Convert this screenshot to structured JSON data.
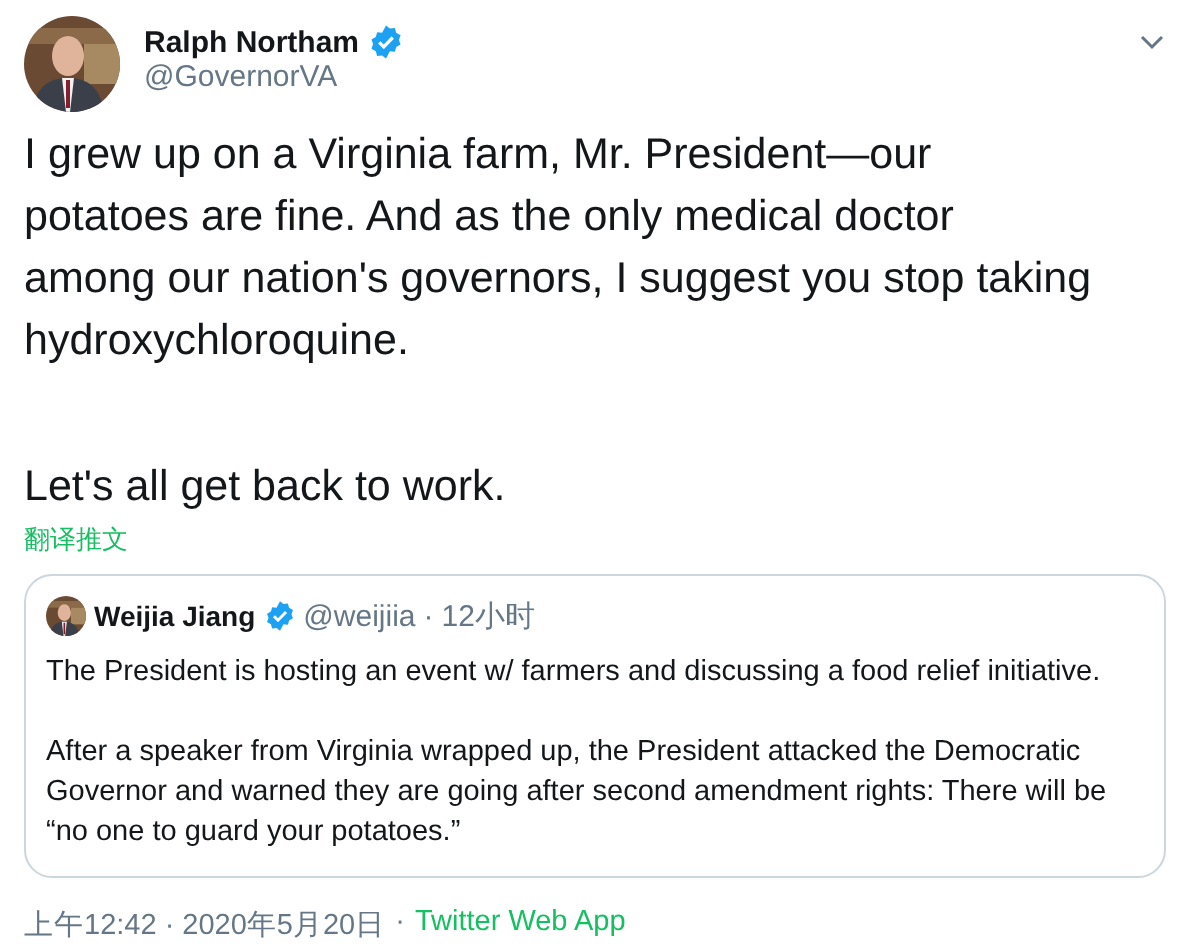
{
  "author": {
    "name": "Ralph Northam",
    "handle": "@GovernorVA",
    "verified": true
  },
  "text": [
    "I grew up on a Virginia farm, Mr. President—our potatoes are fine. And as the only medical doctor among our nation's governors, I suggest you stop taking hydroxychloroquine.",
    "Let's all get back to work."
  ],
  "translate_link": "翻译推文",
  "quoted_tweet": {
    "author": {
      "name": "Weijia Jiang",
      "handle": "@weijiia",
      "verified": true
    },
    "separator": "·",
    "time": "12小时",
    "text": [
      "The President is hosting an event w/ farmers and discussing a food relief initiative.",
      "After a speaker from Virginia wrapped up, the President attacked the Democratic Governor and warned they are going after second amendment rights: There will be “no one to guard your potatoes.”"
    ]
  },
  "timestamp": "上午12:42 · 2020年5月20日",
  "footer_separator": "·",
  "source": "Twitter Web App"
}
